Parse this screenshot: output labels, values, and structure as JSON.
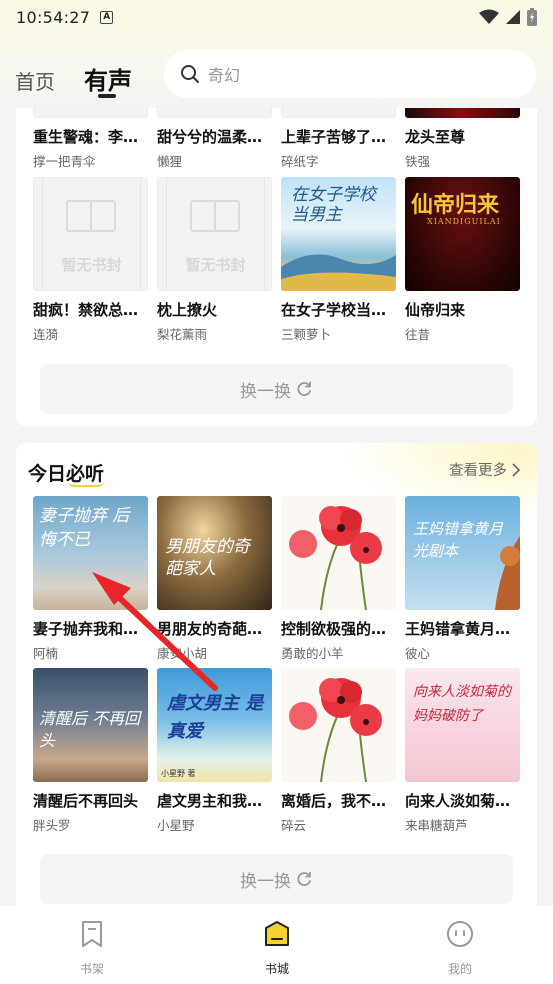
{
  "status_bar": {
    "time": "10:54:27",
    "a_icon": "A"
  },
  "nav": {
    "tab_home": "首页",
    "tab_audio": "有声",
    "search_placeholder": "奇幻"
  },
  "section1": {
    "partial_books": [
      {
        "title": "重生警魂：李沐...",
        "author": "撑一把青伞"
      },
      {
        "title": "甜兮兮的温柔少...",
        "author": "懒狸"
      },
      {
        "title": "上辈子苦够了，...",
        "author": "碎纸字"
      },
      {
        "title": "龙头至尊",
        "author": "铁强"
      }
    ],
    "books": [
      {
        "title": "甜疯！禁欲总裁...",
        "author": "连漪",
        "placeholder_text": "暂无书封"
      },
      {
        "title": "枕上撩火",
        "author": "梨花薰雨",
        "placeholder_text": "暂无书封"
      },
      {
        "title": "在女子学校当男...",
        "author": "三颗萝卜",
        "cover_text": "在女子学校当男主"
      },
      {
        "title": "仙帝归来",
        "author": "往昔",
        "cover_text": "仙帝归来",
        "cover_sub": "XIANDIGUILAI"
      }
    ],
    "swap_label": "换一换"
  },
  "section2": {
    "title": "今日必听",
    "see_more": "查看更多",
    "row1": [
      {
        "title": "妻子抛弃我和女...",
        "author": "阿楠",
        "cover_text": "妻子抛弃 后悔不已"
      },
      {
        "title": "男朋友的奇葩家...",
        "author": "康安小胡",
        "cover_text": "男朋友的奇葩家人"
      },
      {
        "title": "控制欲极强的母...",
        "author": "勇敢的小羊"
      },
      {
        "title": "王妈错拿黄月光...",
        "author": "彼心",
        "cover_text": "王妈错拿黄月光剧本"
      }
    ],
    "row2": [
      {
        "title": "清醒后不再回头",
        "author": "胖头罗",
        "cover_text": "清醒后 不再回头"
      },
      {
        "title": "虐文男主和我的...",
        "author": "小星野",
        "cover_text": "虐文男主 是真爱",
        "cover_sub": "小星野 著"
      },
      {
        "title": "离婚后，我不再...",
        "author": "碎云"
      },
      {
        "title": "向来人淡如菊的...",
        "author": "来串糖葫芦",
        "cover_text": "向来人淡如菊的妈妈破防了"
      }
    ],
    "swap_label": "换一换"
  },
  "bottom_nav": [
    {
      "label": "书架",
      "icon": "bookmark-icon"
    },
    {
      "label": "书城",
      "icon": "bookstore-icon"
    },
    {
      "label": "我的",
      "icon": "profile-face-icon"
    }
  ],
  "colors": {
    "accent": "#f2cf3a",
    "active_nav": "#f5d230"
  }
}
